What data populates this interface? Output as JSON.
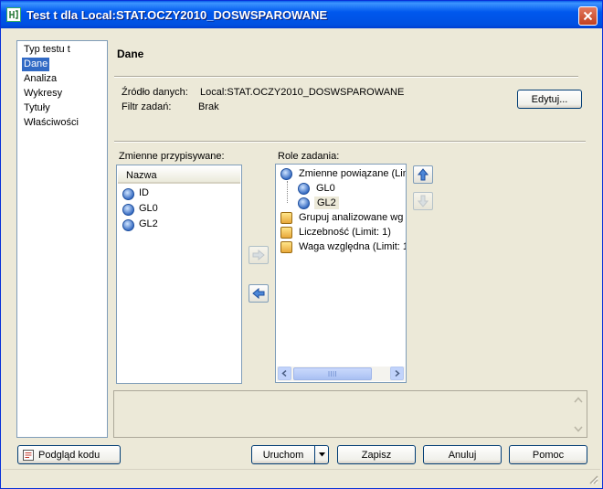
{
  "window": {
    "title": "Test t dla Local:STAT.OCZY2010_DOSWSPAROWANE"
  },
  "nav": {
    "items": [
      "Typ testu t",
      "Dane",
      "Analiza",
      "Wykresy",
      "Tytuły",
      "Właściwości"
    ],
    "selected_index": 1
  },
  "section": {
    "title": "Dane",
    "source_label": "Źródło danych:",
    "source_value": "Local:STAT.OCZY2010_DOSWSPAROWANE",
    "filter_label": "Filtr zadań:",
    "filter_value": "Brak",
    "edit_button": "Edytuj..."
  },
  "assigned": {
    "label": "Zmienne przypisywane:",
    "column_header": "Nazwa",
    "items": [
      "ID",
      "GL0",
      "GL2"
    ]
  },
  "roles": {
    "label": "Role zadania:",
    "items": [
      {
        "text": "Zmienne powiązane  (Lin",
        "level": 0,
        "icon": "numeric-variable-icon"
      },
      {
        "text": "GL0",
        "level": 1,
        "icon": "numeric-variable-icon"
      },
      {
        "text": "GL2",
        "level": 1,
        "icon": "numeric-variable-icon",
        "highlighted": true
      },
      {
        "text": "Grupuj analizowane wg",
        "level": 0,
        "icon": "group-variable-icon"
      },
      {
        "text": "Liczebność  (Limit: 1)",
        "level": 0,
        "icon": "frequency-variable-icon"
      },
      {
        "text": "Waga względna  (Limit: 1",
        "level": 0,
        "icon": "weight-variable-icon"
      }
    ]
  },
  "footer": {
    "preview_button": "Podgląd kodu",
    "run_button": "Uruchom",
    "save_button": "Zapisz",
    "cancel_button": "Anuluj",
    "help_button": "Pomoc"
  }
}
